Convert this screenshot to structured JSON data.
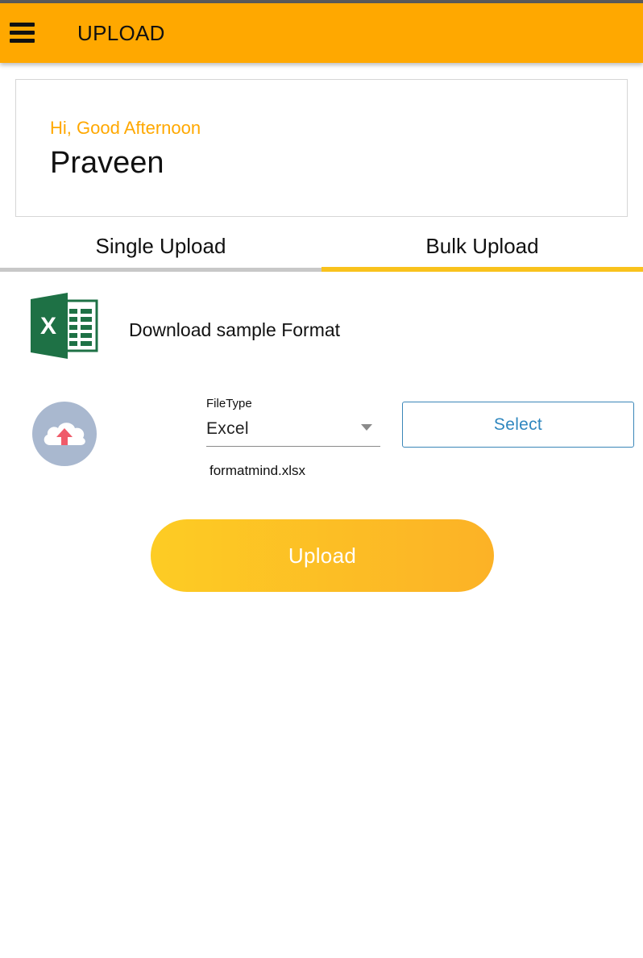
{
  "appbar": {
    "title": "UPLOAD",
    "menu_icon": "hamburger-menu-icon",
    "color": "#ffa800"
  },
  "greeting_card": {
    "greeting": "Hi, Good Afternoon",
    "username": "Praveen"
  },
  "tabs": [
    {
      "label": "Single Upload",
      "active": false
    },
    {
      "label": "Bulk Upload",
      "active": true
    }
  ],
  "download": {
    "icon": "excel-icon",
    "label": "Download sample Format"
  },
  "upload_form": {
    "icon": "cloud-upload-icon",
    "filetype_caption": "FileType",
    "filetype_value": "Excel",
    "select_label": "Select",
    "file_name": "formatmind.xlsx",
    "upload_label": "Upload"
  },
  "colors": {
    "accent": "#ffa800",
    "active_tab_underline": "#f9c21d",
    "select_button": "#2f87bf",
    "excel_green": "#1e7145"
  }
}
